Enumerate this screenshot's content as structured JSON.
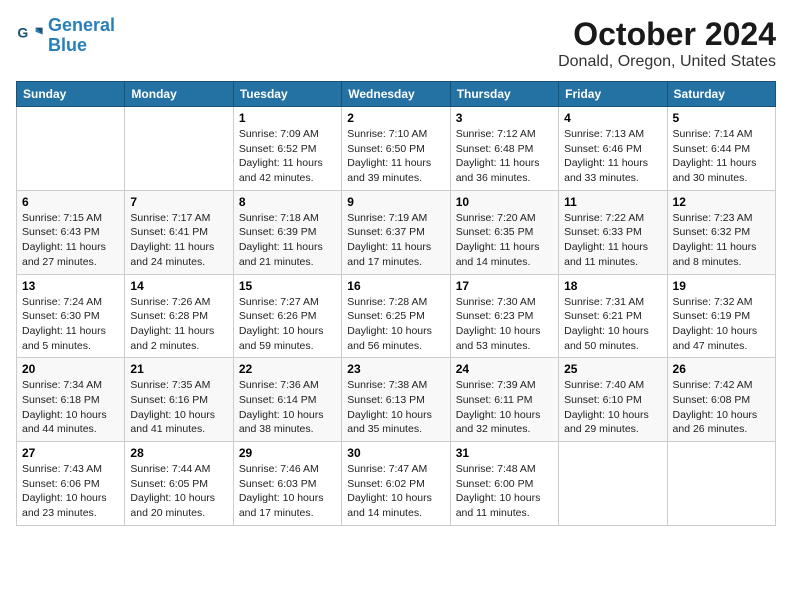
{
  "header": {
    "logo_line1": "General",
    "logo_line2": "Blue",
    "month": "October 2024",
    "location": "Donald, Oregon, United States"
  },
  "weekdays": [
    "Sunday",
    "Monday",
    "Tuesday",
    "Wednesday",
    "Thursday",
    "Friday",
    "Saturday"
  ],
  "weeks": [
    [
      {
        "day": "",
        "detail": ""
      },
      {
        "day": "",
        "detail": ""
      },
      {
        "day": "1",
        "detail": "Sunrise: 7:09 AM\nSunset: 6:52 PM\nDaylight: 11 hours and 42 minutes."
      },
      {
        "day": "2",
        "detail": "Sunrise: 7:10 AM\nSunset: 6:50 PM\nDaylight: 11 hours and 39 minutes."
      },
      {
        "day": "3",
        "detail": "Sunrise: 7:12 AM\nSunset: 6:48 PM\nDaylight: 11 hours and 36 minutes."
      },
      {
        "day": "4",
        "detail": "Sunrise: 7:13 AM\nSunset: 6:46 PM\nDaylight: 11 hours and 33 minutes."
      },
      {
        "day": "5",
        "detail": "Sunrise: 7:14 AM\nSunset: 6:44 PM\nDaylight: 11 hours and 30 minutes."
      }
    ],
    [
      {
        "day": "6",
        "detail": "Sunrise: 7:15 AM\nSunset: 6:43 PM\nDaylight: 11 hours and 27 minutes."
      },
      {
        "day": "7",
        "detail": "Sunrise: 7:17 AM\nSunset: 6:41 PM\nDaylight: 11 hours and 24 minutes."
      },
      {
        "day": "8",
        "detail": "Sunrise: 7:18 AM\nSunset: 6:39 PM\nDaylight: 11 hours and 21 minutes."
      },
      {
        "day": "9",
        "detail": "Sunrise: 7:19 AM\nSunset: 6:37 PM\nDaylight: 11 hours and 17 minutes."
      },
      {
        "day": "10",
        "detail": "Sunrise: 7:20 AM\nSunset: 6:35 PM\nDaylight: 11 hours and 14 minutes."
      },
      {
        "day": "11",
        "detail": "Sunrise: 7:22 AM\nSunset: 6:33 PM\nDaylight: 11 hours and 11 minutes."
      },
      {
        "day": "12",
        "detail": "Sunrise: 7:23 AM\nSunset: 6:32 PM\nDaylight: 11 hours and 8 minutes."
      }
    ],
    [
      {
        "day": "13",
        "detail": "Sunrise: 7:24 AM\nSunset: 6:30 PM\nDaylight: 11 hours and 5 minutes."
      },
      {
        "day": "14",
        "detail": "Sunrise: 7:26 AM\nSunset: 6:28 PM\nDaylight: 11 hours and 2 minutes."
      },
      {
        "day": "15",
        "detail": "Sunrise: 7:27 AM\nSunset: 6:26 PM\nDaylight: 10 hours and 59 minutes."
      },
      {
        "day": "16",
        "detail": "Sunrise: 7:28 AM\nSunset: 6:25 PM\nDaylight: 10 hours and 56 minutes."
      },
      {
        "day": "17",
        "detail": "Sunrise: 7:30 AM\nSunset: 6:23 PM\nDaylight: 10 hours and 53 minutes."
      },
      {
        "day": "18",
        "detail": "Sunrise: 7:31 AM\nSunset: 6:21 PM\nDaylight: 10 hours and 50 minutes."
      },
      {
        "day": "19",
        "detail": "Sunrise: 7:32 AM\nSunset: 6:19 PM\nDaylight: 10 hours and 47 minutes."
      }
    ],
    [
      {
        "day": "20",
        "detail": "Sunrise: 7:34 AM\nSunset: 6:18 PM\nDaylight: 10 hours and 44 minutes."
      },
      {
        "day": "21",
        "detail": "Sunrise: 7:35 AM\nSunset: 6:16 PM\nDaylight: 10 hours and 41 minutes."
      },
      {
        "day": "22",
        "detail": "Sunrise: 7:36 AM\nSunset: 6:14 PM\nDaylight: 10 hours and 38 minutes."
      },
      {
        "day": "23",
        "detail": "Sunrise: 7:38 AM\nSunset: 6:13 PM\nDaylight: 10 hours and 35 minutes."
      },
      {
        "day": "24",
        "detail": "Sunrise: 7:39 AM\nSunset: 6:11 PM\nDaylight: 10 hours and 32 minutes."
      },
      {
        "day": "25",
        "detail": "Sunrise: 7:40 AM\nSunset: 6:10 PM\nDaylight: 10 hours and 29 minutes."
      },
      {
        "day": "26",
        "detail": "Sunrise: 7:42 AM\nSunset: 6:08 PM\nDaylight: 10 hours and 26 minutes."
      }
    ],
    [
      {
        "day": "27",
        "detail": "Sunrise: 7:43 AM\nSunset: 6:06 PM\nDaylight: 10 hours and 23 minutes."
      },
      {
        "day": "28",
        "detail": "Sunrise: 7:44 AM\nSunset: 6:05 PM\nDaylight: 10 hours and 20 minutes."
      },
      {
        "day": "29",
        "detail": "Sunrise: 7:46 AM\nSunset: 6:03 PM\nDaylight: 10 hours and 17 minutes."
      },
      {
        "day": "30",
        "detail": "Sunrise: 7:47 AM\nSunset: 6:02 PM\nDaylight: 10 hours and 14 minutes."
      },
      {
        "day": "31",
        "detail": "Sunrise: 7:48 AM\nSunset: 6:00 PM\nDaylight: 10 hours and 11 minutes."
      },
      {
        "day": "",
        "detail": ""
      },
      {
        "day": "",
        "detail": ""
      }
    ]
  ]
}
